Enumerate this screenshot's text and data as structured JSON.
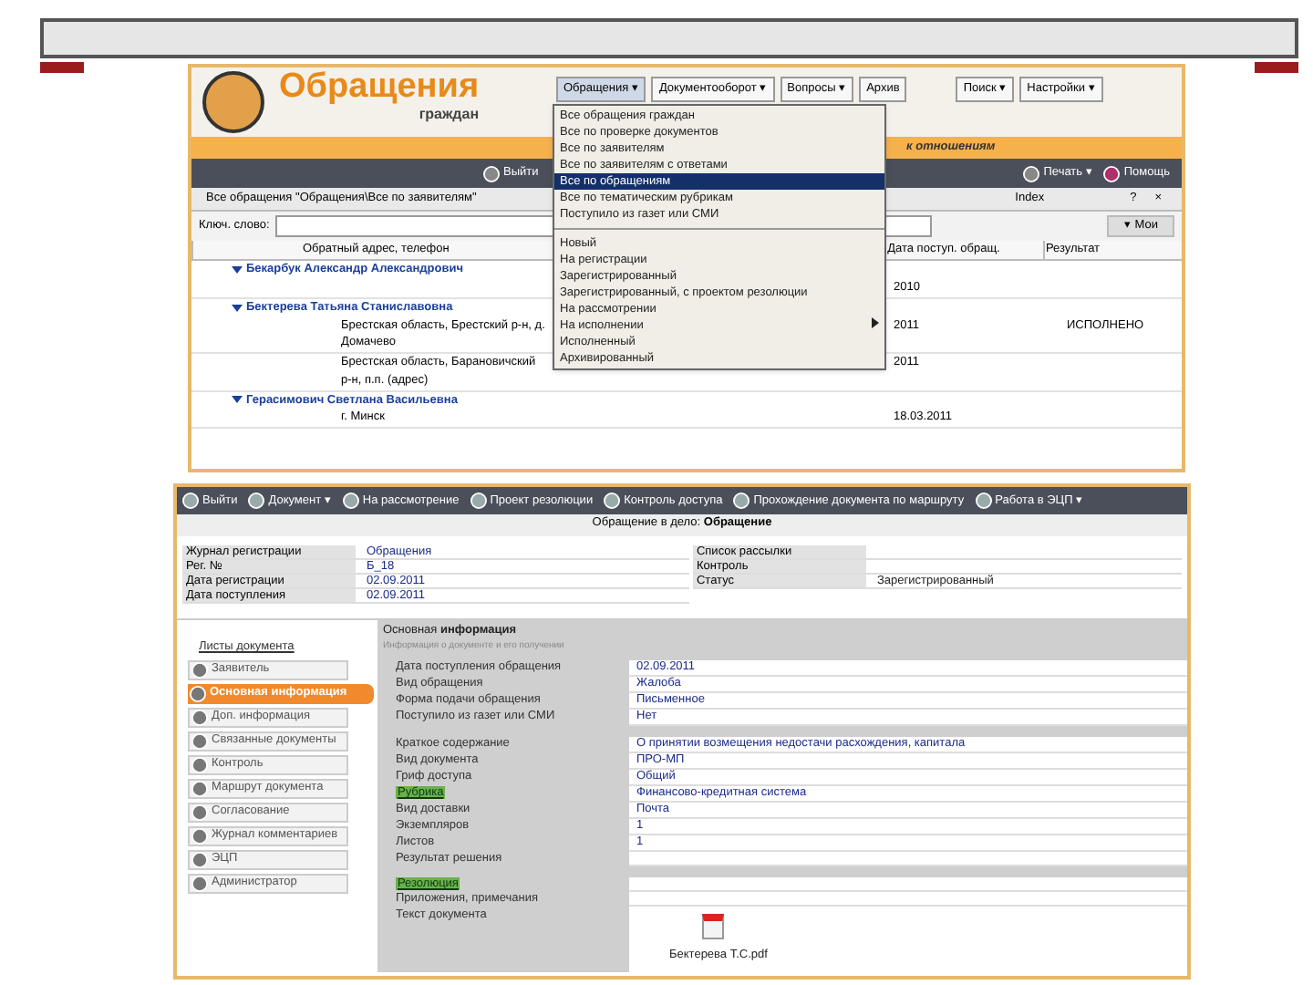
{
  "app_top": {
    "logo_title": "Обращения",
    "logo_subtitle": "граждан",
    "menu": [
      {
        "label": "Обращения ▾",
        "selected": true
      },
      {
        "label": "Документооборот ▾",
        "selected": false
      },
      {
        "label": "Вопросы ▾",
        "selected": false
      },
      {
        "label": "Архив",
        "selected": false
      },
      {
        "label": "Поиск ▾",
        "selected": false
      },
      {
        "label": "Настройки ▾",
        "selected": false
      }
    ],
    "banner": "к отношениям",
    "toolbar": [
      "Выйти",
      "Печать ▾",
      "Помощь"
    ],
    "view_title": "Все обращения \"Обращения\\Все по заявителям\"",
    "view_actions": [
      "Index",
      "?",
      "×"
    ],
    "search_label": "Ключ. слово:",
    "my_tab": "▾ Мои",
    "columns": [
      "Обратный адрес, телефон",
      "Дата поступ. обращ.",
      "Результат"
    ],
    "groups": [
      {
        "name": "Бекарбук Александр Александрович",
        "rows": [
          {
            "date": "2010"
          }
        ]
      },
      {
        "name": "Бектерева Татьяна Станиславовна",
        "rows": [
          {
            "address": "Брестская область, Брестский р-н, д. Домачево",
            "date": "2011",
            "result": "ИСПОЛНЕНО"
          },
          {
            "address": "Брестская область, Барановичский р-н, п.п. (адрес)",
            "date": "2011"
          }
        ]
      },
      {
        "name": "Герасимович Светлана Васильевна",
        "rows": [
          {
            "address": "г. Минск",
            "date": "18.03.2011"
          }
        ]
      }
    ],
    "dropdown": [
      {
        "kind": "item",
        "label": "Все обращения граждан",
        "selected": false
      },
      {
        "kind": "item",
        "label": "Все по проверке документов",
        "selected": false
      },
      {
        "kind": "item",
        "label": "Все по заявителям",
        "selected": false
      },
      {
        "kind": "item",
        "label": "Все по заявителям с ответами",
        "selected": false
      },
      {
        "kind": "item",
        "label": "Все по обращениям",
        "selected": true
      },
      {
        "kind": "item",
        "label": "Все по тематическим рубрикам",
        "selected": false
      },
      {
        "kind": "item",
        "label": "Поступило из газет или СМИ",
        "selected": false
      },
      {
        "kind": "separator"
      },
      {
        "kind": "item",
        "label": "Новый",
        "selected": false
      },
      {
        "kind": "item",
        "label": "На регистрации",
        "selected": false
      },
      {
        "kind": "item",
        "label": "Зарегистрированный",
        "selected": false
      },
      {
        "kind": "item",
        "label": "Зарегистрированный, с проектом резолюции",
        "selected": false
      },
      {
        "kind": "item",
        "label": "На рассмотрении",
        "selected": false
      },
      {
        "kind": "submenu",
        "label": "На исполнении",
        "selected": false
      },
      {
        "kind": "item",
        "label": "Исполненный",
        "selected": false
      },
      {
        "kind": "item",
        "label": "Архивированный",
        "selected": false
      }
    ]
  },
  "app_bottom": {
    "toolbar": [
      "Выйти",
      "Документ ▾",
      "На рассмотрение",
      "Проект резолюции",
      "Контроль доступа",
      "Прохождение документа по маршруту",
      "Работа в ЭЦП ▾"
    ],
    "doc_title": "Обращение в дело: **Обращение**",
    "header_fields": [
      {
        "label": "Журнал регистрации",
        "value": "Обращения"
      },
      {
        "label": "Рег. №",
        "value": "Б_18"
      },
      {
        "label": "Дата регистрации",
        "value": "02.09.2011"
      },
      {
        "label": "Дата поступления",
        "value": "02.09.2011"
      }
    ],
    "header_fields_right": [
      {
        "label": "Список рассылки"
      },
      {
        "label": "Контроль"
      },
      {
        "label": "Статус",
        "value": "Зарегистрированный"
      }
    ],
    "nav_title": "Листы документа",
    "nav": [
      {
        "label": "Заявитель",
        "selected": false
      },
      {
        "label": "Основная информация",
        "selected": true
      },
      {
        "label": "Доп. информация",
        "selected": false
      },
      {
        "label": "Связанные документы",
        "selected": false
      },
      {
        "label": "Контроль",
        "selected": false
      },
      {
        "label": "Маршрут документа",
        "selected": false
      },
      {
        "label": "Согласование",
        "selected": false
      },
      {
        "label": "Журнал комментариев",
        "selected": false
      },
      {
        "label": "ЭЦП",
        "selected": false
      },
      {
        "label": "Администратор",
        "selected": false
      }
    ],
    "section_title": "Основная **информация**",
    "section_subtitle": "Информация о документе и его получении",
    "fields": [
      {
        "kind": "text",
        "label": "Дата поступления обращения",
        "value": "02.09.2011"
      },
      {
        "kind": "text",
        "label": "Вид обращения",
        "value": "Жалоба"
      },
      {
        "kind": "text",
        "label": "Форма подачи обращения",
        "value": "Письменное"
      },
      {
        "kind": "text",
        "label": "Поступило из газет или СМИ",
        "value": "Нет"
      },
      {
        "kind": "text",
        "label": "Краткое содержание",
        "value": "О принятии возмещения недостачи расхождения, капитала"
      },
      {
        "kind": "text",
        "label": "Вид документа",
        "value": "ПРО-МП"
      },
      {
        "kind": "text",
        "label": "Гриф доступа",
        "value": "Общий"
      },
      {
        "kind": "link",
        "label": "Рубрика",
        "value": "Финансово-кредитная система"
      },
      {
        "kind": "text",
        "label": "Вид доставки",
        "value": "Почта"
      },
      {
        "kind": "text",
        "label": "Экземпляров",
        "value": "1"
      },
      {
        "kind": "text",
        "label": "Листов",
        "value": "1"
      },
      {
        "kind": "text",
        "label": "Результат решения"
      },
      {
        "kind": "link",
        "label": "Резолюция"
      },
      {
        "kind": "text",
        "label": "Приложения, примечания"
      },
      {
        "kind": "file",
        "label": "Текст документа",
        "value": "Бектерева Т.С.pdf"
      }
    ]
  }
}
